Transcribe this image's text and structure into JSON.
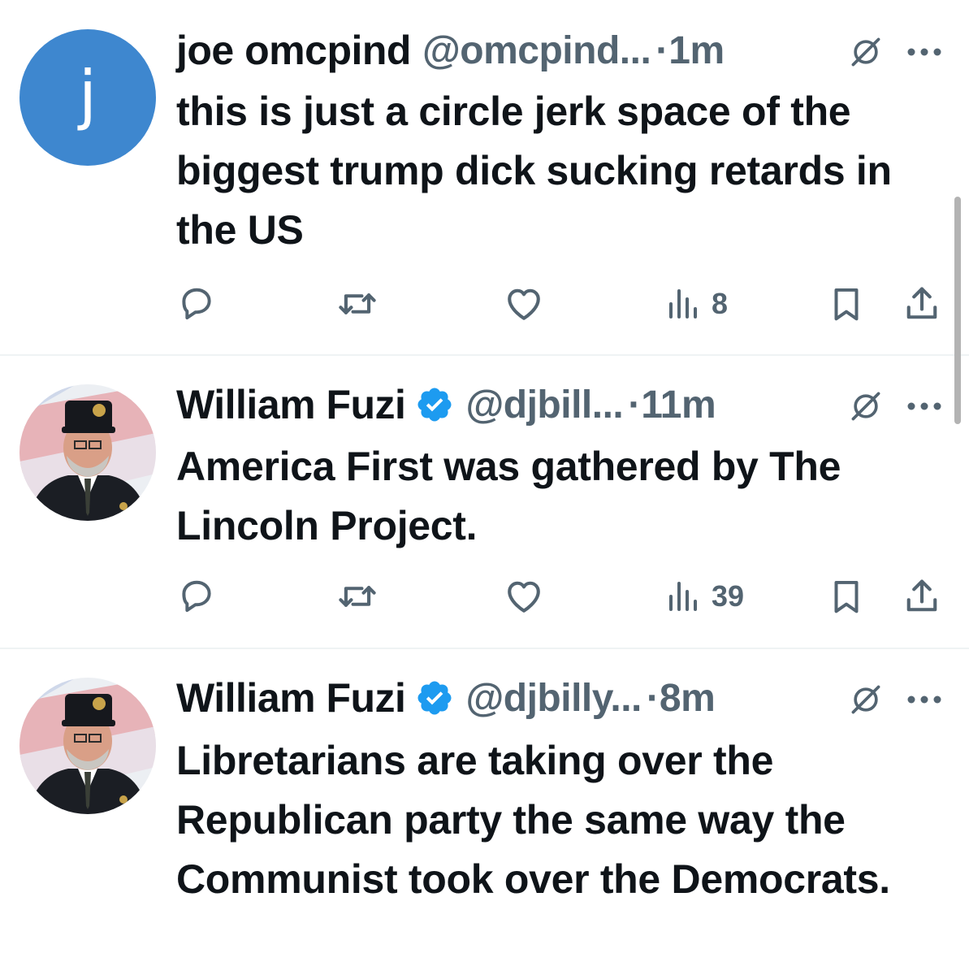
{
  "colors": {
    "text": "#0f1419",
    "secondary": "#536471",
    "verified": "#1d9bf0",
    "divider": "#eff3f4",
    "avatar_letter_bg": "#3e87cf"
  },
  "posts": [
    {
      "avatar_letter": "j",
      "display_name": "joe omcpind",
      "verified": false,
      "handle": "@omcpind...",
      "separator": "·",
      "time": "1m",
      "text": "this is just a circle jerk space of the biggest trump dick sucking retards in the US",
      "views": "8"
    },
    {
      "avatar": "photo of man in VFW cap",
      "display_name": "William Fuzi",
      "verified": true,
      "handle": "@djbill...",
      "separator": "·",
      "time": "11m",
      "text": "America First was gathered by The Lincoln Project.",
      "views": "39"
    },
    {
      "avatar": "photo of man in VFW cap",
      "display_name": "William Fuzi",
      "verified": true,
      "handle": "@djbilly...",
      "separator": "·",
      "time": "8m",
      "text": "Libretarians are taking over the Republican party the same way the Communist took over the Democrats."
    }
  ],
  "icons": {
    "reply": "reply-icon",
    "repost": "repost-icon",
    "like": "heart-icon",
    "views": "views-chart-icon",
    "bookmark": "bookmark-icon",
    "share": "share-icon",
    "grok": "grok-icon",
    "more": "more-dots-icon",
    "verified": "verified-badge-icon"
  }
}
